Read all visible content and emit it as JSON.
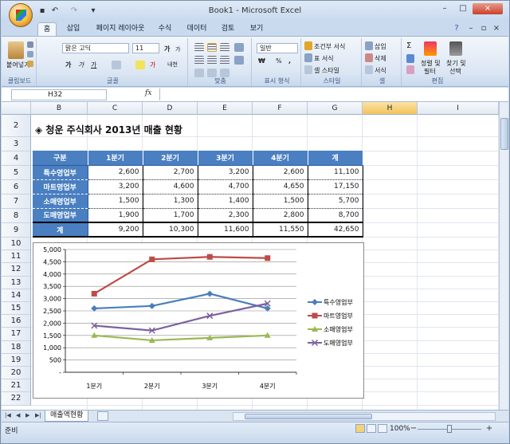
{
  "window": {
    "title": "Book1 - Microsoft Excel",
    "minimize": "–",
    "restore": "□",
    "close": "×"
  },
  "ribbon_tabs": [
    "홈",
    "삽입",
    "페이지 레이아웃",
    "수식",
    "데이터",
    "검토",
    "보기"
  ],
  "ribbon": {
    "clipboard": {
      "label": "클립보드",
      "paste": "붙여넣기"
    },
    "font": {
      "label": "글꼴",
      "font_name": "맑은 고딕",
      "font_size": "11",
      "bold": "가",
      "italic": "가",
      "underline": "가",
      "grow": "가",
      "shrink": "가",
      "phonetic": "내천"
    },
    "alignment": {
      "label": "맞춤"
    },
    "number": {
      "label": "표시 형식",
      "format": "일반",
      "currency": "₩",
      "percent": "%",
      "comma": ","
    },
    "styles": {
      "label": "스타일",
      "conditional": "조건부 서식",
      "table": "표 서식",
      "cell": "셀 스타일"
    },
    "cells": {
      "label": "셀",
      "insert": "삽입",
      "delete": "삭제",
      "format": "서식"
    },
    "editing": {
      "label": "편집",
      "sort": "정렬 및",
      "sort2": "필터",
      "find": "찾기 및",
      "find2": "선택"
    }
  },
  "formula_bar": {
    "name_box": "H32",
    "fx": "fx",
    "formula": ""
  },
  "columns": [
    "B",
    "C",
    "D",
    "E",
    "F",
    "G",
    "H",
    "I"
  ],
  "rows": [
    "2",
    "3",
    "4",
    "5",
    "6",
    "7",
    "8",
    "9",
    "10",
    "11",
    "12",
    "13",
    "14",
    "15",
    "16",
    "17",
    "18",
    "19",
    "20",
    "21",
    "22"
  ],
  "selected_column": "H",
  "sheet_title": "◈ 청운 주식회사 2013년 매출 현황",
  "table": {
    "headers": [
      "구분",
      "1분기",
      "2분기",
      "3분기",
      "4분기",
      "계"
    ],
    "rows": [
      {
        "label": "특수영업부",
        "values": [
          "2,600",
          "2,700",
          "3,200",
          "2,600",
          "11,100"
        ]
      },
      {
        "label": "마트영업부",
        "values": [
          "3,200",
          "4,600",
          "4,700",
          "4,650",
          "17,150"
        ]
      },
      {
        "label": "소매영업부",
        "values": [
          "1,500",
          "1,300",
          "1,400",
          "1,500",
          "5,700"
        ]
      },
      {
        "label": "도매영업부",
        "values": [
          "1,900",
          "1,700",
          "2,300",
          "2,800",
          "8,700"
        ]
      }
    ],
    "total": {
      "label": "계",
      "values": [
        "9,200",
        "10,300",
        "11,600",
        "11,550",
        "42,650"
      ]
    }
  },
  "chart_data": {
    "type": "line",
    "categories": [
      "1분기",
      "2분기",
      "3분기",
      "4분기"
    ],
    "ylim": [
      0,
      5000
    ],
    "yticks": [
      "5,000",
      "4,500",
      "4,000",
      "3,500",
      "3,000",
      "2,500",
      "2,000",
      "1,500",
      "1,000",
      "500",
      "-"
    ],
    "grid": true,
    "legend": "right",
    "series": [
      {
        "name": "특수영업부",
        "values": [
          2600,
          2700,
          3200,
          2600
        ],
        "color": "#4a7ebb",
        "marker": "diamond"
      },
      {
        "name": "마트영업부",
        "values": [
          3200,
          4600,
          4700,
          4650
        ],
        "color": "#be4b48",
        "marker": "square"
      },
      {
        "name": "소매영업부",
        "values": [
          1500,
          1300,
          1400,
          1500
        ],
        "color": "#98b954",
        "marker": "triangle"
      },
      {
        "name": "도매영업부",
        "values": [
          1900,
          1700,
          2300,
          2800
        ],
        "color": "#7d60a0",
        "marker": "x"
      }
    ]
  },
  "sheet_tab": "매출액현황",
  "status": {
    "ready": "준비",
    "zoom": "100%"
  },
  "colors": {
    "header_fill": "#4a7fc1",
    "selected_header": "#f3c35c"
  }
}
